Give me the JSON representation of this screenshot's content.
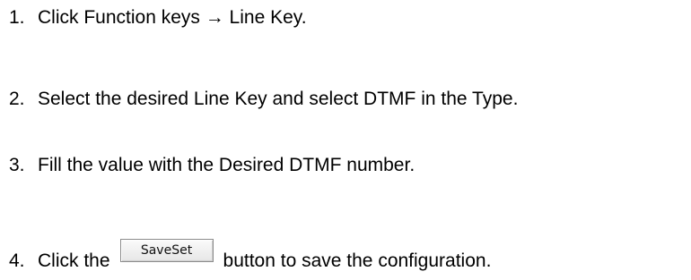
{
  "steps": [
    {
      "number": "1.",
      "text": "Click Function keys → Line Key."
    },
    {
      "number": "2.",
      "text": "Select the desired Line Key and select DTMF in the Type."
    },
    {
      "number": "3.",
      "text": "Fill the value with the Desired DTMF number."
    },
    {
      "number": "4.",
      "text_before": "Click the",
      "button_label": "SaveSet",
      "text_after": "button to save the configuration."
    }
  ]
}
